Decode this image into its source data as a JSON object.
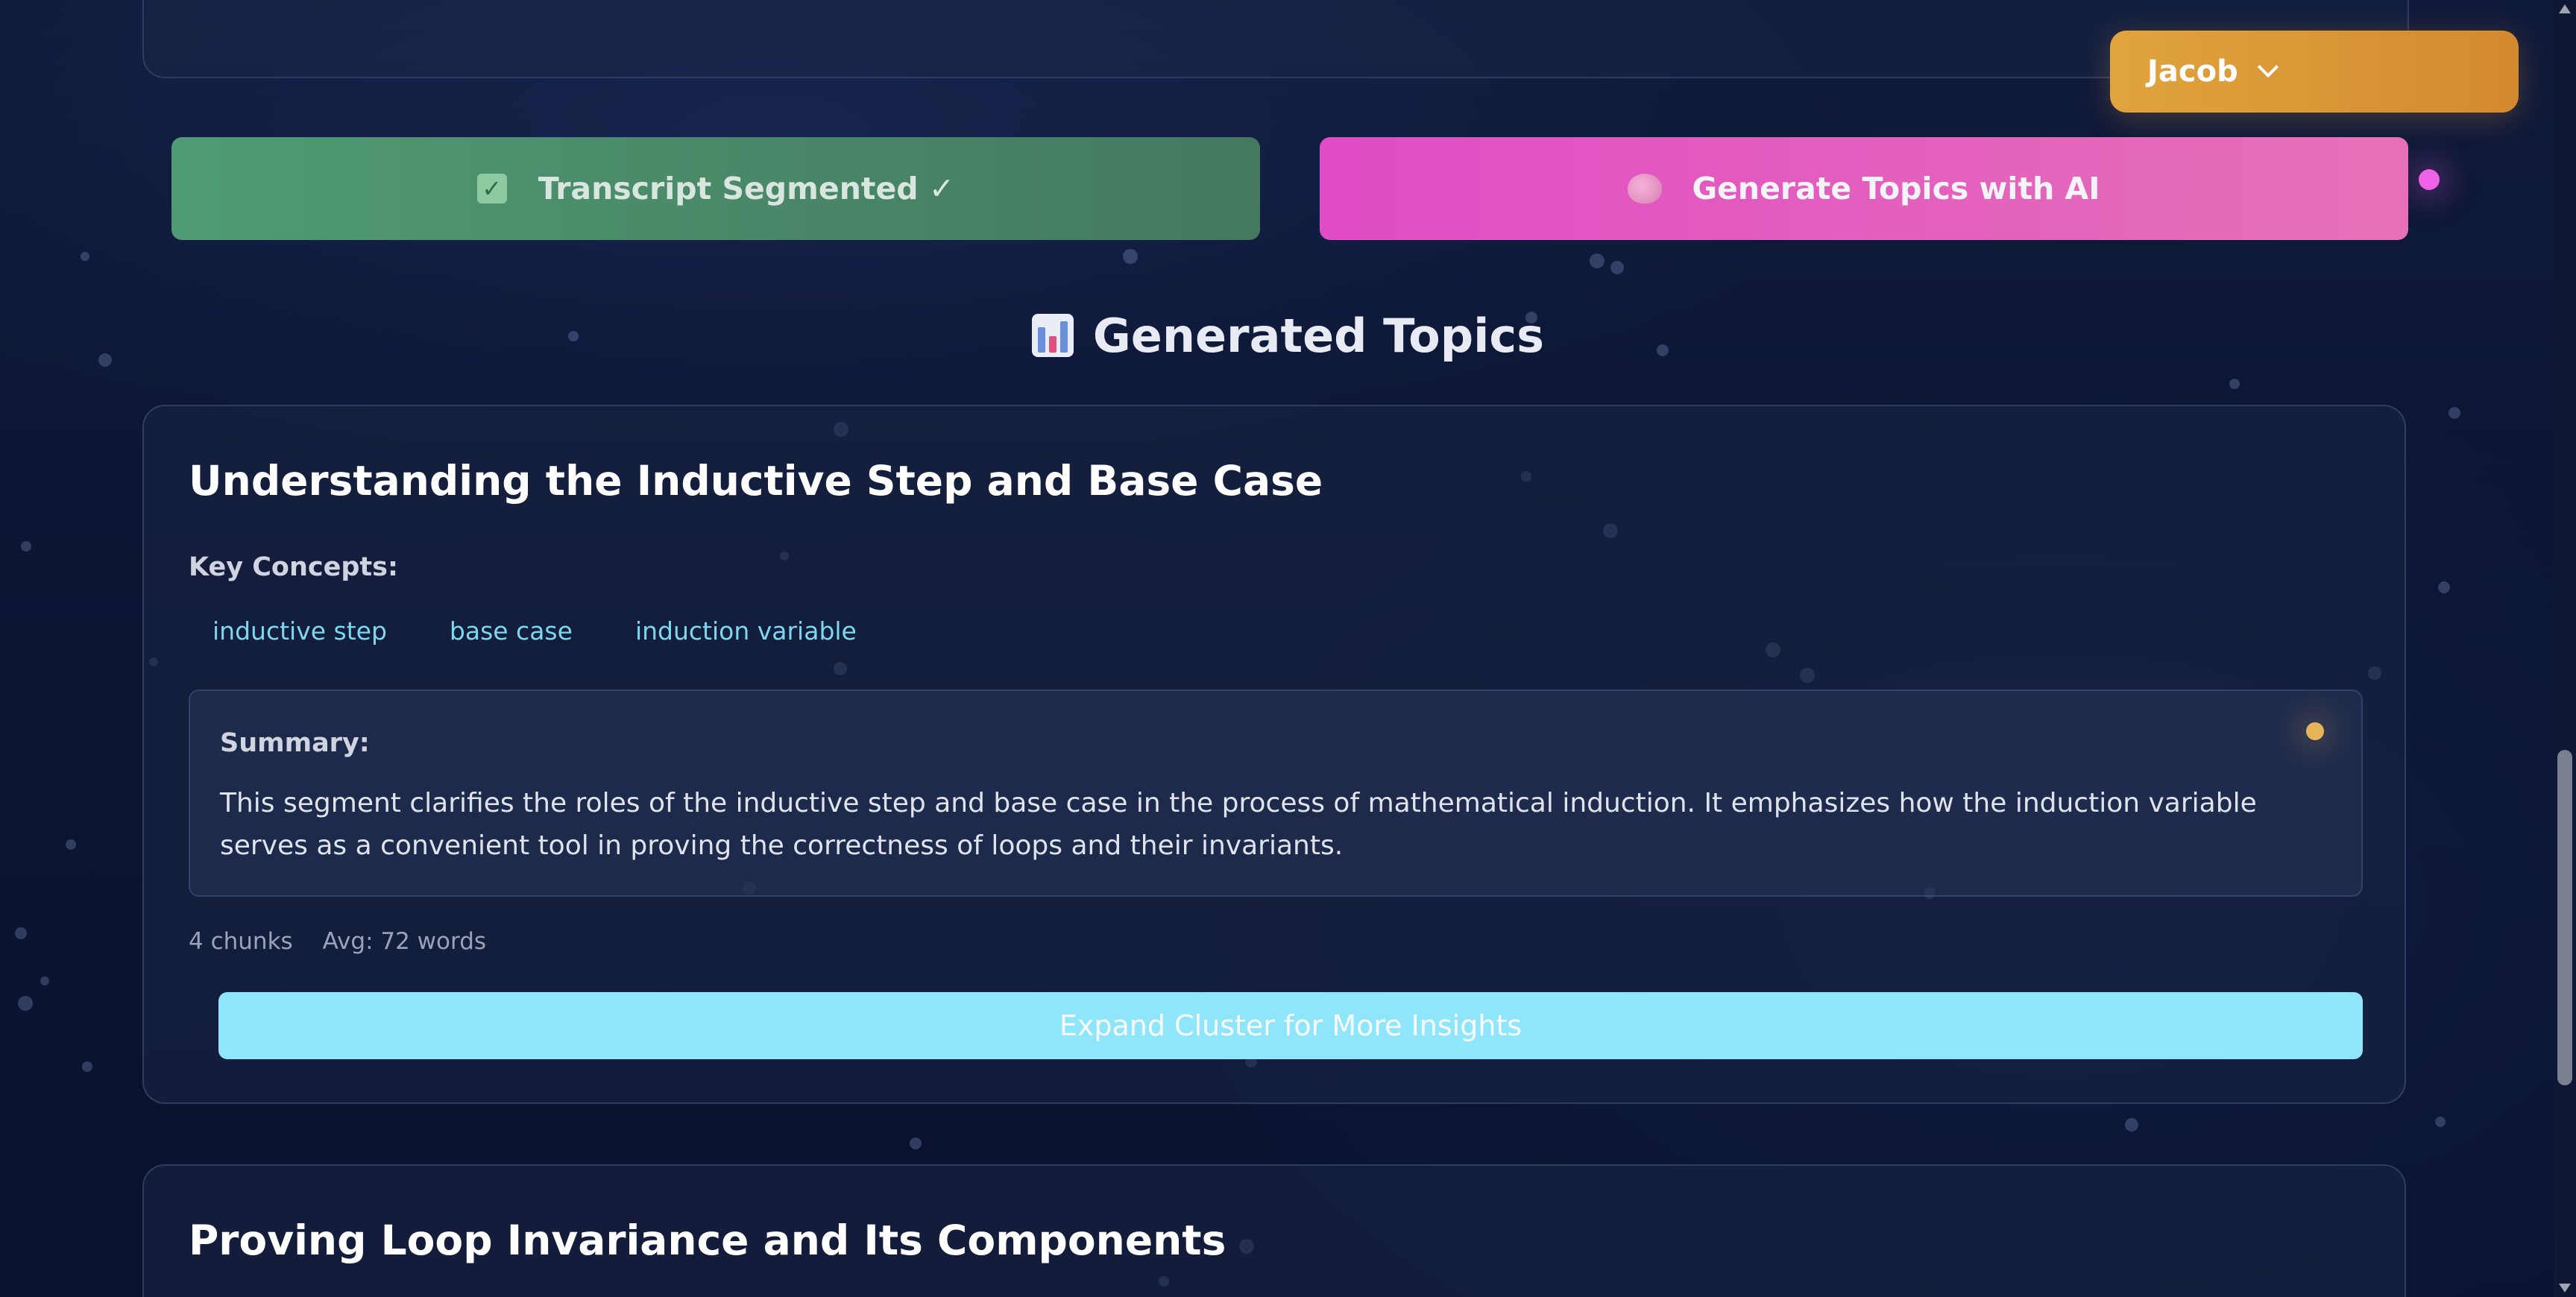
{
  "user_menu": {
    "name": "Jacob",
    "icon": "chevron-down-icon"
  },
  "actions": {
    "segment_button_label": "Transcript Segmented ✓",
    "segment_icon": "check-box-icon",
    "generate_button_label": "Generate Topics with AI",
    "generate_icon": "brain-icon"
  },
  "section": {
    "title": "Generated Topics",
    "icon": "bar-chart-icon"
  },
  "topics": [
    {
      "title": "Understanding the Inductive Step and Base Case",
      "key_concepts_label": "Key Concepts:",
      "concepts": [
        "inductive step",
        "base case",
        "induction variable"
      ],
      "summary_label": "Summary:",
      "summary": "This segment clarifies the roles of the inductive step and base case in the process of mathematical induction. It emphasizes how the induction variable serves as a convenient tool in proving the correctness of loops and their invariants.",
      "chunks": "4 chunks",
      "avg_words": "Avg: 72 words",
      "expand_label": "Expand Cluster for More Insights"
    },
    {
      "title": "Proving Loop Invariance and Its Components"
    }
  ],
  "colors": {
    "segment_button": "#4f9b73",
    "generate_button": "#e04cc5",
    "user_menu": "#e0a43e",
    "expand_button": "#8fe6fb",
    "tag_text": "#7fd6ef"
  }
}
